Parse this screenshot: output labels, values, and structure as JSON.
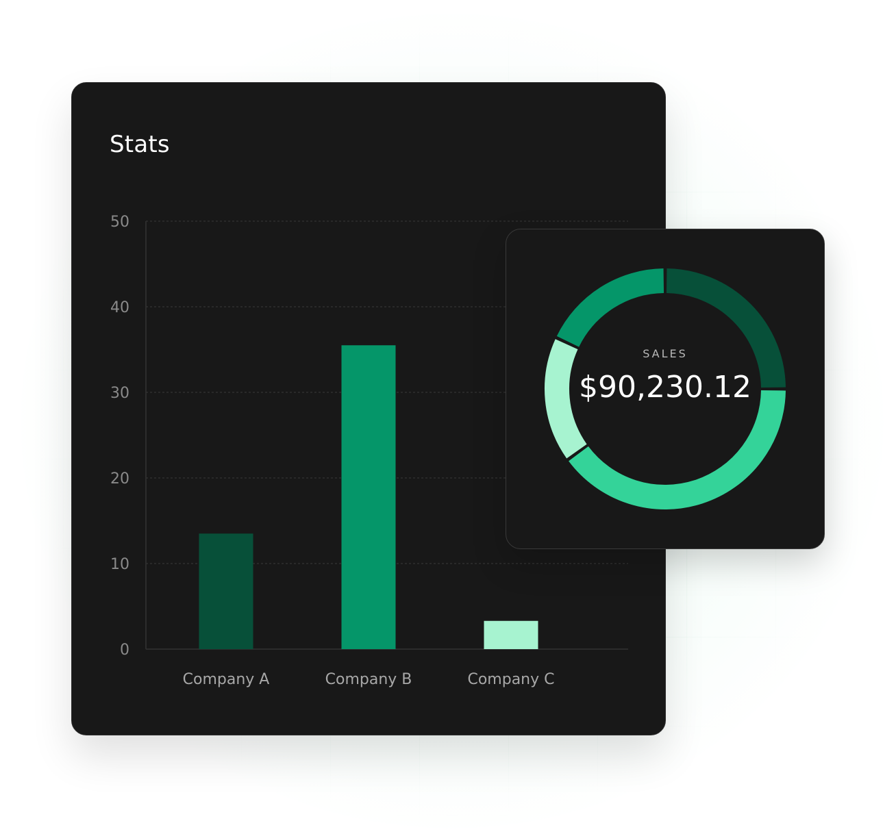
{
  "stats_card": {
    "title": "Stats"
  },
  "sales_card": {
    "label": "SALES",
    "value": "$90,230.12"
  },
  "chart_data": [
    {
      "type": "bar",
      "title": "Stats",
      "categories": [
        "Company A",
        "Company B",
        "Company C"
      ],
      "values": [
        13.5,
        35.5,
        3.3
      ],
      "colors": [
        "#075039",
        "#059669",
        "#a7f3d0"
      ],
      "yticks": [
        "0",
        "10",
        "20",
        "30",
        "40",
        "50"
      ],
      "ylim": [
        0,
        50
      ],
      "grid": true,
      "xlabel": "",
      "ylabel": ""
    },
    {
      "type": "pie",
      "variant": "donut",
      "center_label": "SALES",
      "center_value": "$90,230.12",
      "slices": [
        {
          "value": 25,
          "color": "#075039"
        },
        {
          "value": 40,
          "color": "#34d399"
        },
        {
          "value": 17,
          "color": "#a7f3d0"
        },
        {
          "value": 18,
          "color": "#059669"
        }
      ]
    }
  ],
  "colors": {
    "background": "#ffffff",
    "card": "#181818",
    "dark_green": "#075039",
    "green": "#059669",
    "bright_green": "#34d399",
    "light_green": "#a7f3d0"
  }
}
